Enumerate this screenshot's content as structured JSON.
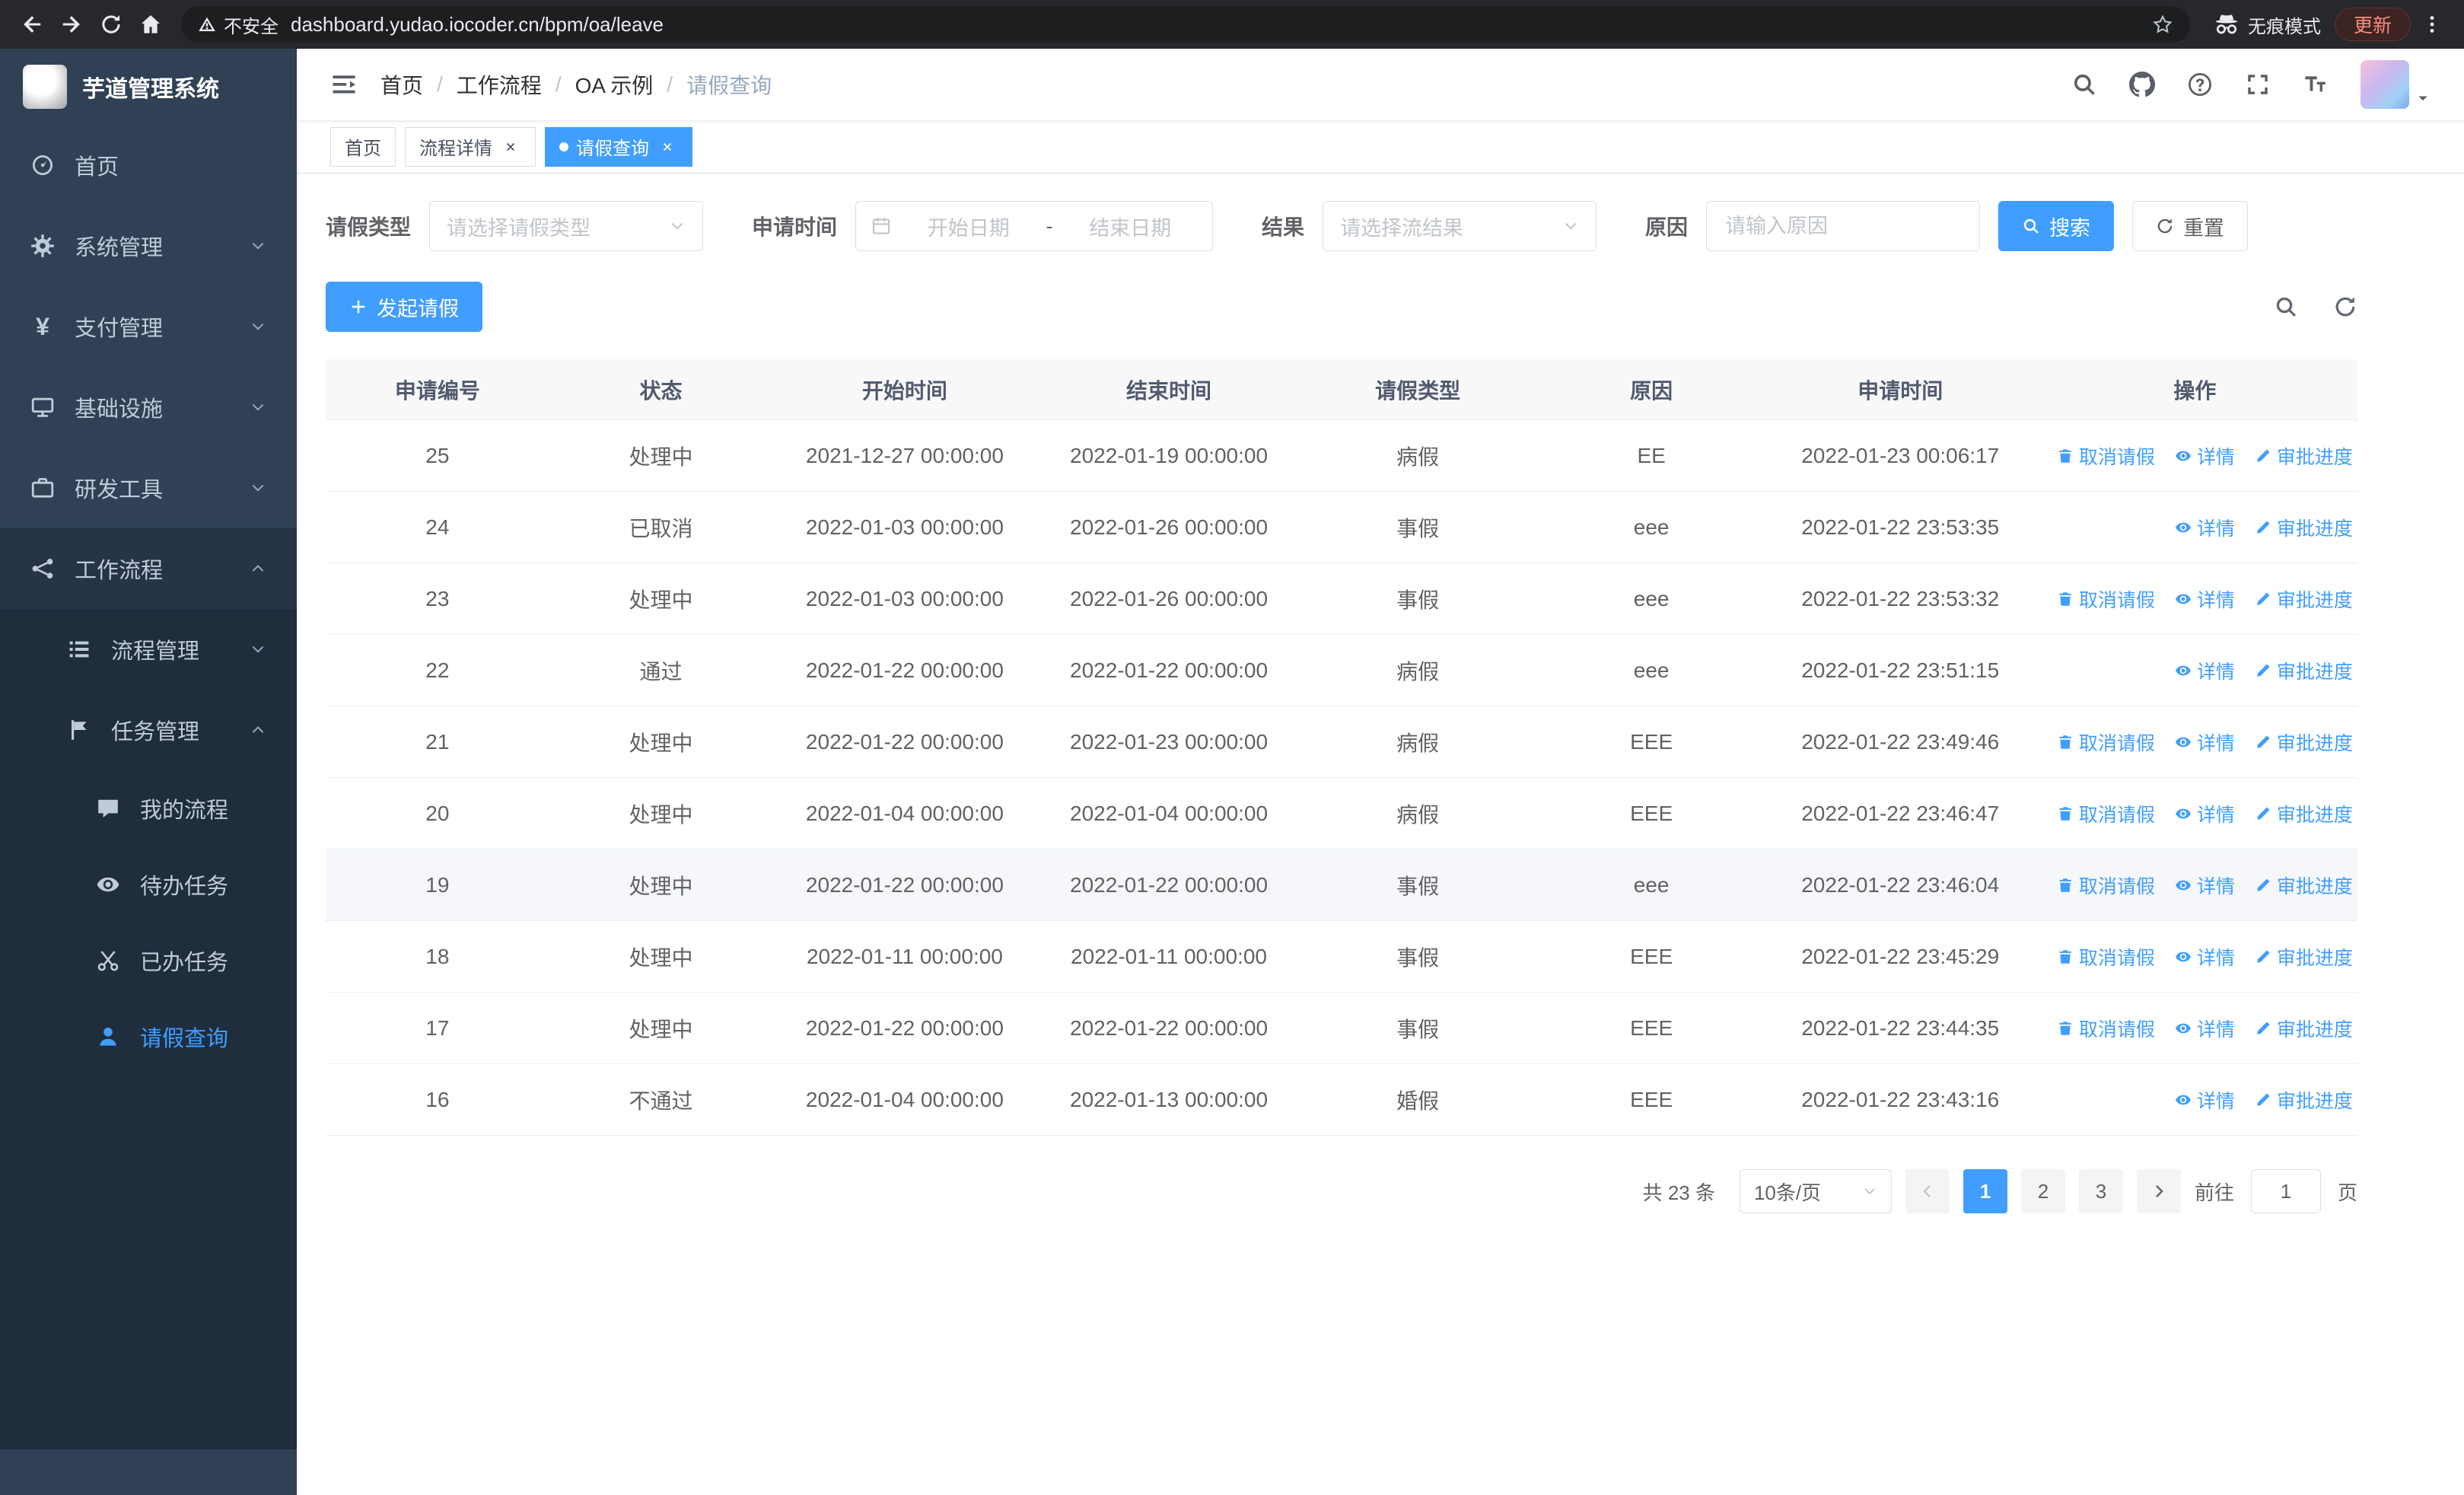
{
  "browser": {
    "security_label": "不安全",
    "url": "dashboard.yudao.iocoder.cn/bpm/oa/leave",
    "incognito_label": "无痕模式",
    "update_label": "更新"
  },
  "sidebar": {
    "logo_title": "芋道管理系统",
    "menu": [
      {
        "label": "首页",
        "icon": "dashboard",
        "chevron": null
      },
      {
        "label": "系统管理",
        "icon": "gear",
        "chevron": "down"
      },
      {
        "label": "支付管理",
        "icon": "yen",
        "chevron": "down"
      },
      {
        "label": "基础设施",
        "icon": "infrastructure",
        "chevron": "down"
      },
      {
        "label": "研发工具",
        "icon": "tools",
        "chevron": "down"
      },
      {
        "label": "工作流程",
        "icon": "workflow",
        "chevron": "up",
        "open": true
      }
    ],
    "submenu": [
      {
        "label": "流程管理",
        "icon": "process",
        "chevron": "down"
      },
      {
        "label": "任务管理",
        "icon": "task",
        "chevron": "up"
      }
    ],
    "task_children": [
      {
        "label": "我的流程",
        "icon": "chat",
        "active": false
      },
      {
        "label": "待办任务",
        "icon": "eye",
        "active": false
      },
      {
        "label": "已办任务",
        "icon": "scissors",
        "active": false
      },
      {
        "label": "请假查询",
        "icon": "user",
        "active": true
      }
    ]
  },
  "header": {
    "breadcrumb": [
      {
        "label": "首页"
      },
      {
        "label": "工作流程"
      },
      {
        "label": "OA 示例"
      },
      {
        "label": "请假查询"
      }
    ]
  },
  "tabs": [
    {
      "label": "首页",
      "closable": false,
      "active": false
    },
    {
      "label": "流程详情",
      "closable": true,
      "active": false
    },
    {
      "label": "请假查询",
      "closable": true,
      "active": true
    }
  ],
  "filters": {
    "leave_type_label": "请假类型",
    "leave_type_placeholder": "请选择请假类型",
    "apply_time_label": "申请时间",
    "start_date_placeholder": "开始日期",
    "date_separator": "-",
    "end_date_placeholder": "结束日期",
    "result_label": "结果",
    "result_placeholder": "请选择流结果",
    "reason_label": "原因",
    "reason_placeholder": "请输入原因",
    "search_label": "搜索",
    "reset_label": "重置"
  },
  "toolbar": {
    "create_label": "发起请假"
  },
  "table": {
    "columns": [
      "申请编号",
      "状态",
      "开始时间",
      "结束时间",
      "请假类型",
      "原因",
      "申请时间",
      "操作"
    ],
    "action_labels": {
      "cancel": "取消请假",
      "detail": "详情",
      "progress": "审批进度"
    },
    "rows": [
      {
        "id": "25",
        "status": "处理中",
        "start": "2021-12-27 00:00:00",
        "end": "2022-01-19 00:00:00",
        "type": "病假",
        "reason": "EE",
        "applyTime": "2022-01-23 00:06:17",
        "actions": [
          "cancel",
          "detail",
          "progress"
        ],
        "highlighted": false
      },
      {
        "id": "24",
        "status": "已取消",
        "start": "2022-01-03 00:00:00",
        "end": "2022-01-26 00:00:00",
        "type": "事假",
        "reason": "eee",
        "applyTime": "2022-01-22 23:53:35",
        "actions": [
          "detail",
          "progress"
        ],
        "highlighted": false
      },
      {
        "id": "23",
        "status": "处理中",
        "start": "2022-01-03 00:00:00",
        "end": "2022-01-26 00:00:00",
        "type": "事假",
        "reason": "eee",
        "applyTime": "2022-01-22 23:53:32",
        "actions": [
          "cancel",
          "detail",
          "progress"
        ],
        "highlighted": false
      },
      {
        "id": "22",
        "status": "通过",
        "start": "2022-01-22 00:00:00",
        "end": "2022-01-22 00:00:00",
        "type": "病假",
        "reason": "eee",
        "applyTime": "2022-01-22 23:51:15",
        "actions": [
          "detail",
          "progress"
        ],
        "highlighted": false
      },
      {
        "id": "21",
        "status": "处理中",
        "start": "2022-01-22 00:00:00",
        "end": "2022-01-23 00:00:00",
        "type": "病假",
        "reason": "EEE",
        "applyTime": "2022-01-22 23:49:46",
        "actions": [
          "cancel",
          "detail",
          "progress"
        ],
        "highlighted": false
      },
      {
        "id": "20",
        "status": "处理中",
        "start": "2022-01-04 00:00:00",
        "end": "2022-01-04 00:00:00",
        "type": "病假",
        "reason": "EEE",
        "applyTime": "2022-01-22 23:46:47",
        "actions": [
          "cancel",
          "detail",
          "progress"
        ],
        "highlighted": false
      },
      {
        "id": "19",
        "status": "处理中",
        "start": "2022-01-22 00:00:00",
        "end": "2022-01-22 00:00:00",
        "type": "事假",
        "reason": "eee",
        "applyTime": "2022-01-22 23:46:04",
        "actions": [
          "cancel",
          "detail",
          "progress"
        ],
        "highlighted": true
      },
      {
        "id": "18",
        "status": "处理中",
        "start": "2022-01-11 00:00:00",
        "end": "2022-01-11 00:00:00",
        "type": "事假",
        "reason": "EEE",
        "applyTime": "2022-01-22 23:45:29",
        "actions": [
          "cancel",
          "detail",
          "progress"
        ],
        "highlighted": false
      },
      {
        "id": "17",
        "status": "处理中",
        "start": "2022-01-22 00:00:00",
        "end": "2022-01-22 00:00:00",
        "type": "事假",
        "reason": "EEE",
        "applyTime": "2022-01-22 23:44:35",
        "actions": [
          "cancel",
          "detail",
          "progress"
        ],
        "highlighted": false
      },
      {
        "id": "16",
        "status": "不通过",
        "start": "2022-01-04 00:00:00",
        "end": "2022-01-13 00:00:00",
        "type": "婚假",
        "reason": "EEE",
        "applyTime": "2022-01-22 23:43:16",
        "actions": [
          "detail",
          "progress"
        ],
        "highlighted": false
      }
    ]
  },
  "pagination": {
    "total_label": "共 23 条",
    "page_size_label": "10条/页",
    "pages": [
      "1",
      "2",
      "3"
    ],
    "active_page": "1",
    "goto_label": "前往",
    "goto_value": "1",
    "page_suffix": "页"
  }
}
